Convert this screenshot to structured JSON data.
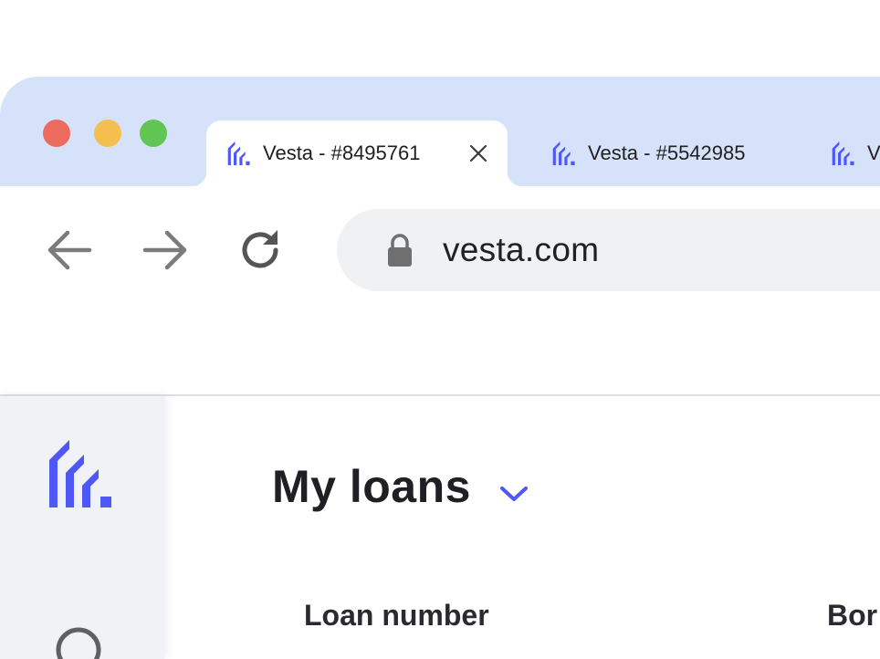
{
  "browser": {
    "tabs": [
      {
        "title": "Vesta - #8495761",
        "active": true,
        "icon": "vesta-logo-icon"
      },
      {
        "title": "Vesta - #5542985",
        "active": false,
        "icon": "vesta-logo-icon"
      },
      {
        "title": "V",
        "active": false,
        "icon": "vesta-logo-icon"
      }
    ],
    "url": "vesta.com",
    "colors": {
      "tabstrip": "#d6e2f9",
      "brand": "#4f57f5",
      "traffic_red": "#ec6a5e",
      "traffic_yellow": "#f4bf4f",
      "traffic_green": "#61c554"
    }
  },
  "app": {
    "page_title": "My loans",
    "table": {
      "columns": [
        "Loan number",
        "Bor"
      ]
    }
  }
}
